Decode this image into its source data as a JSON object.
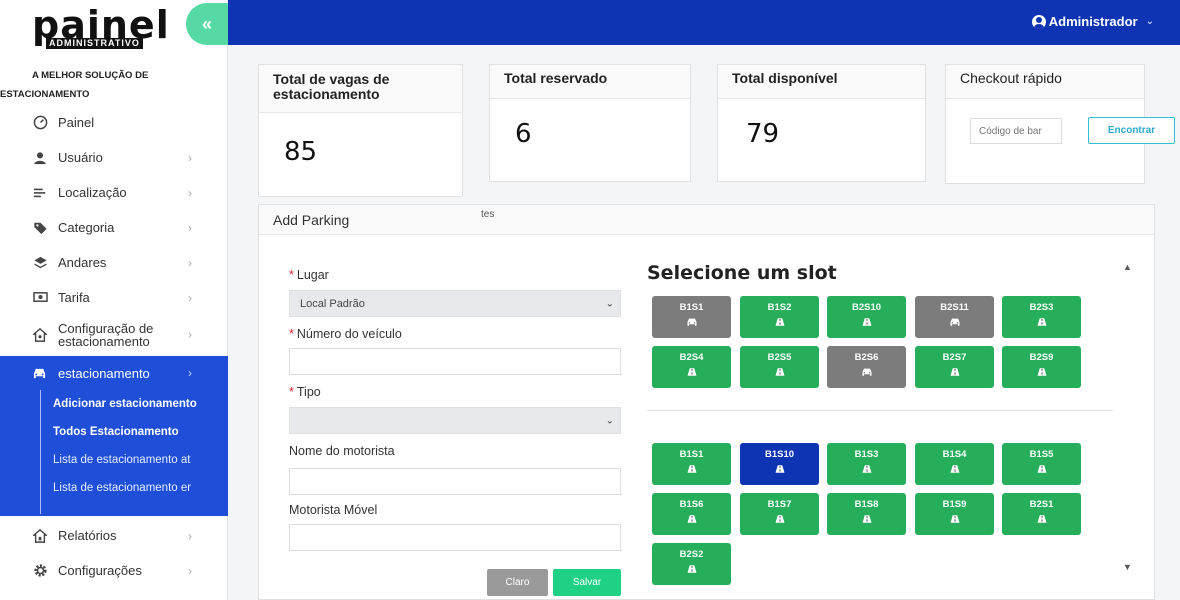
{
  "sidebar": {
    "logo_main": "painel",
    "logo_sub": "ADMINISTRATIVO",
    "tagline_line1": "A MELHOR SOLUÇÃO DE",
    "tagline_line2": "ESTACIONAMENTO",
    "items": [
      {
        "label": "Painel",
        "icon": "dashboard-icon"
      },
      {
        "label": "Usuário",
        "icon": "user-icon"
      },
      {
        "label": "Localização",
        "icon": "location-icon"
      },
      {
        "label": "Categoria",
        "icon": "tag-icon"
      },
      {
        "label": "Andares",
        "icon": "layers-icon"
      },
      {
        "label": "Tarifa",
        "icon": "money-icon"
      },
      {
        "label": "Configuração de estacionamento",
        "icon": "home-gear-icon"
      }
    ],
    "active": {
      "label": "estacionamento",
      "icon": "car-icon",
      "sub_items": [
        "Adicionar estacionamento",
        "Todos Estacionamento",
        "Lista de estacionamento at",
        "Lista de estacionamento er"
      ]
    },
    "bottom_items": [
      {
        "label": "Relatórios",
        "icon": "home-chart-icon"
      },
      {
        "label": "Configurações",
        "icon": "gear-icon"
      }
    ]
  },
  "header": {
    "user_label": "Administrador"
  },
  "stats": {
    "total_label": "Total de vagas de estacionamento",
    "total_value": "85",
    "reserved_label": "Total reservado",
    "reserved_value": "6",
    "available_label": "Total disponível",
    "available_value": "79",
    "checkout_label": "Checkout rápido",
    "barcode_placeholder": "Código de bar",
    "find_label": "Encontrar"
  },
  "form": {
    "panel_title": "Add Parking",
    "stray_text": "tes",
    "place_label": "Lugar",
    "place_value": "Local Padrão",
    "vehicle_label": "Número do veículo",
    "type_label": "Tipo",
    "driver_label": "Nome do motorista",
    "mobile_label": "Motorista Móvel",
    "clear_label": "Claro",
    "save_label": "Salvar"
  },
  "slots": {
    "title": "Selecione um slot",
    "group1": [
      {
        "code": "B1S1",
        "status": "occupied"
      },
      {
        "code": "B1S2",
        "status": "free"
      },
      {
        "code": "B2S10",
        "status": "free"
      },
      {
        "code": "B2S11",
        "status": "occupied"
      },
      {
        "code": "B2S3",
        "status": "free"
      },
      {
        "code": "B2S4",
        "status": "free"
      },
      {
        "code": "B2S5",
        "status": "free"
      },
      {
        "code": "B2S6",
        "status": "occupied"
      },
      {
        "code": "B2S7",
        "status": "free"
      },
      {
        "code": "B2S9",
        "status": "free"
      }
    ],
    "group2": [
      {
        "code": "B1S1",
        "status": "free"
      },
      {
        "code": "B1S10",
        "status": "selected"
      },
      {
        "code": "B1S3",
        "status": "free"
      },
      {
        "code": "B1S4",
        "status": "free"
      },
      {
        "code": "B1S5",
        "status": "free"
      },
      {
        "code": "B1S6",
        "status": "free"
      },
      {
        "code": "B1S7",
        "status": "free"
      },
      {
        "code": "B1S8",
        "status": "free"
      },
      {
        "code": "B1S9",
        "status": "free"
      },
      {
        "code": "B2S1",
        "status": "free"
      },
      {
        "code": "B2S2",
        "status": "free"
      }
    ]
  },
  "colors": {
    "header": "#0e34b4",
    "active_nav": "#1f4fd8",
    "free_slot": "#27ae5b",
    "occupied_slot": "#7c7c7c",
    "selected_slot": "#0e34b4",
    "save_button": "#1fd184"
  }
}
